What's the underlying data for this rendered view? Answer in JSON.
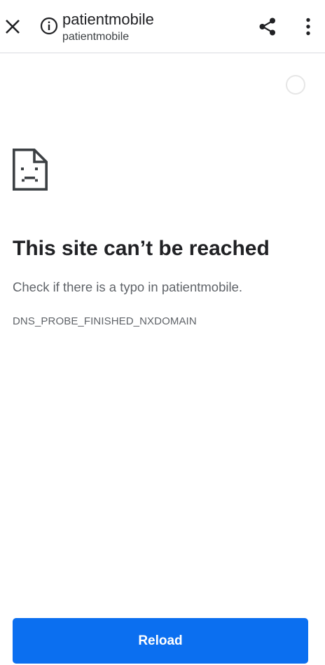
{
  "toolbar": {
    "title": "patientmobile",
    "url": "patientmobile",
    "close_icon": "close-icon",
    "info_icon": "info-icon",
    "share_icon": "share-icon",
    "more_icon": "more-vert-icon"
  },
  "loading": {
    "icon": "loading-spinner-icon"
  },
  "error": {
    "icon": "sad-file-icon",
    "heading": "This site can’t be reached",
    "message": "Check if there is a typo in patientmobile.",
    "code": "DNS_PROBE_FINISHED_NXDOMAIN"
  },
  "actions": {
    "reload_label": "Reload"
  },
  "colors": {
    "accent": "#0b6ff0",
    "text_primary": "#202124",
    "text_secondary": "#5f6368",
    "divider": "#dadce0"
  }
}
